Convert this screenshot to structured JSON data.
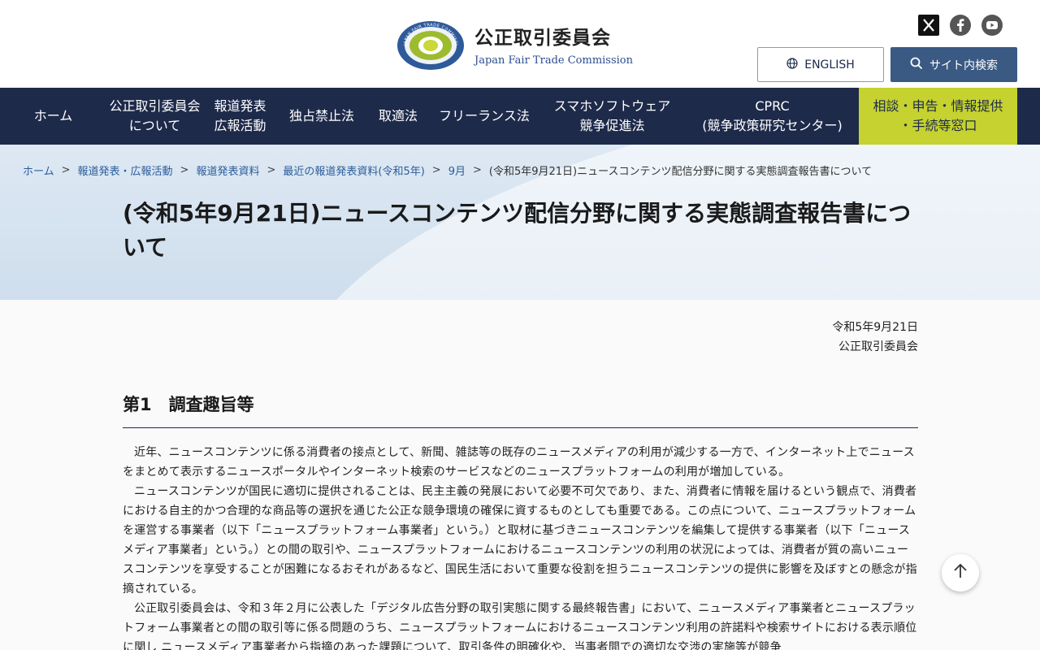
{
  "header": {
    "org_name_ja": "公正取引委員会",
    "org_name_en": "Japan Fair Trade Commission",
    "logo_ring_text": "JAPAN FAIR TRADE COMMISSION",
    "social": [
      {
        "icon": "x-icon",
        "label": "X"
      },
      {
        "icon": "facebook-icon",
        "label": "Facebook"
      },
      {
        "icon": "youtube-icon",
        "label": "YouTube"
      }
    ],
    "english_label": "ENGLISH",
    "search_label": "サイト内検索"
  },
  "nav": {
    "items": [
      {
        "label": "ホーム"
      },
      {
        "label": "公正取引委員会\nについて"
      },
      {
        "label": "報道発表\n広報活動"
      },
      {
        "label": "独占禁止法"
      },
      {
        "label": "取適法"
      },
      {
        "label": "フリーランス法"
      },
      {
        "label": "スマホソフトウェア\n競争促進法"
      },
      {
        "label": "CPRC\n(競争政策研究センター)"
      },
      {
        "label": "相談・申告・情報提供\n・手続等窓口"
      }
    ]
  },
  "breadcrumb": {
    "links": [
      "ホーム",
      "報道発表・広報活動",
      "報道発表資料",
      "最近の報道発表資料(令和5年)",
      "9月"
    ],
    "separator": ">",
    "current": "(令和5年9月21日)ニュースコンテンツ配信分野に関する実態調査報告書について"
  },
  "page_title": "(令和5年9月21日)ニュースコンテンツ配信分野に関する実態調査報告書について",
  "content": {
    "date": "令和5年9月21日",
    "issuer": "公正取引委員会",
    "section_heading": "第1　調査趣旨等",
    "paragraphs": [
      "近年、ニュースコンテンツに係る消費者の接点として、新聞、雑誌等の既存のニュースメディアの利用が減少する一方で、インターネット上でニュースをまとめて表示するニュースポータルやインターネット検索のサービスなどのニュースプラットフォームの利用が増加している。",
      "ニュースコンテンツが国民に適切に提供されることは、民主主義の発展において必要不可欠であり、また、消費者に情報を届けるという観点で、消費者における自主的かつ合理的な商品等の選択を通じた公正な競争環境の確保に資するものとしても重要である。この点について、ニュースプラットフォームを運営する事業者（以下「ニュースプラットフォーム事業者」という。）と取材に基づきニュースコンテンツを編集して提供する事業者（以下「ニュースメディア事業者」という。）との間の取引や、ニュースプラットフォームにおけるニュースコンテンツの利用の状況によっては、消費者が質の高いニュースコンテンツを享受することが困難になるおそれがあるなど、国民生活において重要な役割を担うニュースコンテンツの提供に影響を及ぼすとの懸念が指摘されている。",
      "公正取引委員会は、令和３年２月に公表した「デジタル広告分野の取引実態に関する最終報告書」において、ニュースメディア事業者とニュースプラットフォーム事業者との間の取引等に係る問題のうち、ニュースプラットフォームにおけるニュースコンテンツ利用の許諾料や検索サイトにおける表示順位に関し ニュースメディア事業者から指摘のあった課題について、取引条件の明確化や、当事者間での適切な交渉の実施等が競争"
    ]
  },
  "back_to_top_icon": "arrow-up-icon",
  "colors": {
    "nav_bg": "#1e2a4a",
    "consult_bg": "#c5d22f",
    "search_btn_bg": "#3a5a84",
    "link": "#2a5d9a"
  }
}
